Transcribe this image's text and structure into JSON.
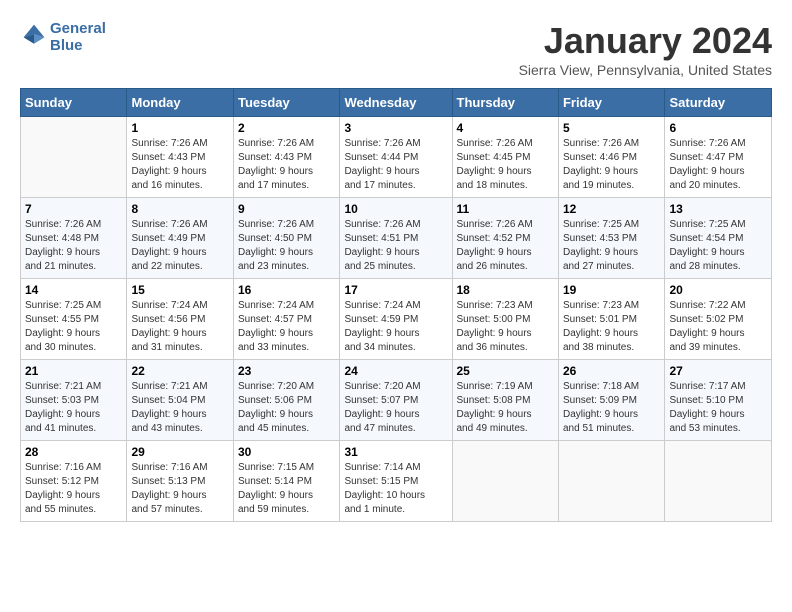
{
  "header": {
    "logo_line1": "General",
    "logo_line2": "Blue",
    "title": "January 2024",
    "subtitle": "Sierra View, Pennsylvania, United States"
  },
  "weekdays": [
    "Sunday",
    "Monday",
    "Tuesday",
    "Wednesday",
    "Thursday",
    "Friday",
    "Saturday"
  ],
  "weeks": [
    [
      {
        "day": "",
        "info": ""
      },
      {
        "day": "1",
        "info": "Sunrise: 7:26 AM\nSunset: 4:43 PM\nDaylight: 9 hours\nand 16 minutes."
      },
      {
        "day": "2",
        "info": "Sunrise: 7:26 AM\nSunset: 4:43 PM\nDaylight: 9 hours\nand 17 minutes."
      },
      {
        "day": "3",
        "info": "Sunrise: 7:26 AM\nSunset: 4:44 PM\nDaylight: 9 hours\nand 17 minutes."
      },
      {
        "day": "4",
        "info": "Sunrise: 7:26 AM\nSunset: 4:45 PM\nDaylight: 9 hours\nand 18 minutes."
      },
      {
        "day": "5",
        "info": "Sunrise: 7:26 AM\nSunset: 4:46 PM\nDaylight: 9 hours\nand 19 minutes."
      },
      {
        "day": "6",
        "info": "Sunrise: 7:26 AM\nSunset: 4:47 PM\nDaylight: 9 hours\nand 20 minutes."
      }
    ],
    [
      {
        "day": "7",
        "info": "Sunrise: 7:26 AM\nSunset: 4:48 PM\nDaylight: 9 hours\nand 21 minutes."
      },
      {
        "day": "8",
        "info": "Sunrise: 7:26 AM\nSunset: 4:49 PM\nDaylight: 9 hours\nand 22 minutes."
      },
      {
        "day": "9",
        "info": "Sunrise: 7:26 AM\nSunset: 4:50 PM\nDaylight: 9 hours\nand 23 minutes."
      },
      {
        "day": "10",
        "info": "Sunrise: 7:26 AM\nSunset: 4:51 PM\nDaylight: 9 hours\nand 25 minutes."
      },
      {
        "day": "11",
        "info": "Sunrise: 7:26 AM\nSunset: 4:52 PM\nDaylight: 9 hours\nand 26 minutes."
      },
      {
        "day": "12",
        "info": "Sunrise: 7:25 AM\nSunset: 4:53 PM\nDaylight: 9 hours\nand 27 minutes."
      },
      {
        "day": "13",
        "info": "Sunrise: 7:25 AM\nSunset: 4:54 PM\nDaylight: 9 hours\nand 28 minutes."
      }
    ],
    [
      {
        "day": "14",
        "info": "Sunrise: 7:25 AM\nSunset: 4:55 PM\nDaylight: 9 hours\nand 30 minutes."
      },
      {
        "day": "15",
        "info": "Sunrise: 7:24 AM\nSunset: 4:56 PM\nDaylight: 9 hours\nand 31 minutes."
      },
      {
        "day": "16",
        "info": "Sunrise: 7:24 AM\nSunset: 4:57 PM\nDaylight: 9 hours\nand 33 minutes."
      },
      {
        "day": "17",
        "info": "Sunrise: 7:24 AM\nSunset: 4:59 PM\nDaylight: 9 hours\nand 34 minutes."
      },
      {
        "day": "18",
        "info": "Sunrise: 7:23 AM\nSunset: 5:00 PM\nDaylight: 9 hours\nand 36 minutes."
      },
      {
        "day": "19",
        "info": "Sunrise: 7:23 AM\nSunset: 5:01 PM\nDaylight: 9 hours\nand 38 minutes."
      },
      {
        "day": "20",
        "info": "Sunrise: 7:22 AM\nSunset: 5:02 PM\nDaylight: 9 hours\nand 39 minutes."
      }
    ],
    [
      {
        "day": "21",
        "info": "Sunrise: 7:21 AM\nSunset: 5:03 PM\nDaylight: 9 hours\nand 41 minutes."
      },
      {
        "day": "22",
        "info": "Sunrise: 7:21 AM\nSunset: 5:04 PM\nDaylight: 9 hours\nand 43 minutes."
      },
      {
        "day": "23",
        "info": "Sunrise: 7:20 AM\nSunset: 5:06 PM\nDaylight: 9 hours\nand 45 minutes."
      },
      {
        "day": "24",
        "info": "Sunrise: 7:20 AM\nSunset: 5:07 PM\nDaylight: 9 hours\nand 47 minutes."
      },
      {
        "day": "25",
        "info": "Sunrise: 7:19 AM\nSunset: 5:08 PM\nDaylight: 9 hours\nand 49 minutes."
      },
      {
        "day": "26",
        "info": "Sunrise: 7:18 AM\nSunset: 5:09 PM\nDaylight: 9 hours\nand 51 minutes."
      },
      {
        "day": "27",
        "info": "Sunrise: 7:17 AM\nSunset: 5:10 PM\nDaylight: 9 hours\nand 53 minutes."
      }
    ],
    [
      {
        "day": "28",
        "info": "Sunrise: 7:16 AM\nSunset: 5:12 PM\nDaylight: 9 hours\nand 55 minutes."
      },
      {
        "day": "29",
        "info": "Sunrise: 7:16 AM\nSunset: 5:13 PM\nDaylight: 9 hours\nand 57 minutes."
      },
      {
        "day": "30",
        "info": "Sunrise: 7:15 AM\nSunset: 5:14 PM\nDaylight: 9 hours\nand 59 minutes."
      },
      {
        "day": "31",
        "info": "Sunrise: 7:14 AM\nSunset: 5:15 PM\nDaylight: 10 hours\nand 1 minute."
      },
      {
        "day": "",
        "info": ""
      },
      {
        "day": "",
        "info": ""
      },
      {
        "day": "",
        "info": ""
      }
    ]
  ]
}
